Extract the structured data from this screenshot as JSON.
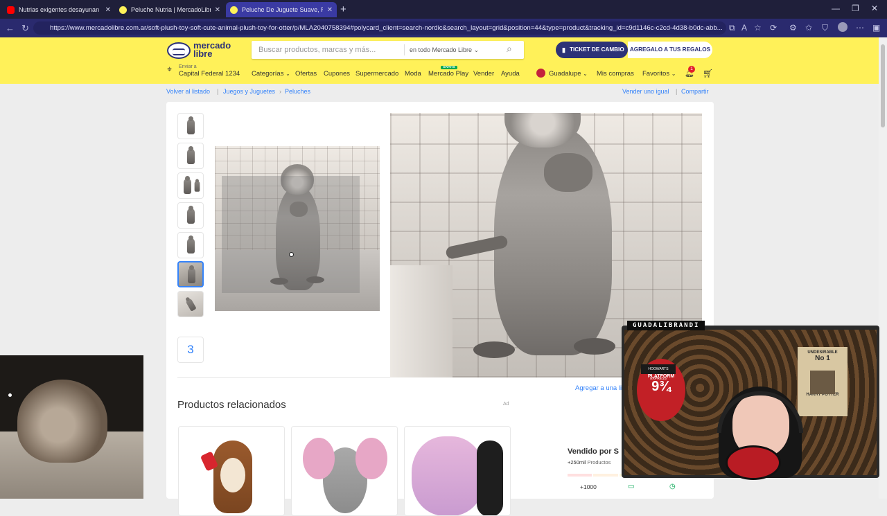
{
  "browser": {
    "tabs": [
      {
        "title": "Nutrias exigentes desayunan con",
        "favicon_color": "#ff0000"
      },
      {
        "title": "Peluche Nutria | MercadoLibre 📦",
        "favicon_color": "#fff159"
      },
      {
        "title": "Peluche De Juguete Suave, Regalo",
        "favicon_color": "#fff159"
      }
    ],
    "new_tab": "+",
    "url": "https://www.mercadolibre.com.ar/soft-plush-toy-soft-cute-animal-plush-toy-for-otter/p/MLA2040758394#polycard_client=search-nordic&search_layout=grid&position=44&type=product&tracking_id=c9d1146c-c2cd-4d38-b0dc-abb..."
  },
  "header": {
    "logo_line1": "mercado",
    "logo_line2": "libre",
    "search_placeholder": "Buscar productos, marcas y más...",
    "search_scope": "en todo Mercado Libre",
    "ticket_button": "TICKET DE CAMBIO",
    "regalo_button": "AGREGALO A TUS REGALOS",
    "location_label": "Enviar a",
    "location_value": "Capital Federal 1234",
    "nav": [
      "Categorías",
      "Ofertas",
      "Cupones",
      "Supermercado",
      "Moda",
      "Mercado Play",
      "Vender",
      "Ayuda"
    ],
    "gratis_badge": "GRATIS",
    "user": "Guadalupe",
    "mis_compras": "Mis compras",
    "favoritos": "Favoritos",
    "notif_count": "1"
  },
  "breadcrumb": {
    "back": "Volver al listado",
    "items": [
      "Juegos y Juguetes",
      "Peluches"
    ],
    "vender": "Vender uno igual",
    "compartir": "Compartir"
  },
  "gallery": {
    "more_count": "3",
    "selected_index": 5
  },
  "related": {
    "title": "Productos relacionados",
    "ad": "Ad"
  },
  "sidebar": {
    "agregar": "Agregar a una lis",
    "vendido_por": "Vendido por S",
    "ventas_count": "+250mil",
    "ventas_label": "Productos",
    "plus1000": "+1000"
  },
  "overlay": {
    "streamer_name": "GUADALIBRANDI",
    "sign1": "HOGWARTS EXPRESS",
    "sign2": "PLATFORM",
    "sign3": "9¾",
    "poster1": "UNDESIRABLE",
    "poster2": "No 1",
    "poster3": "HARRY POTTER"
  },
  "colors": {
    "ml_yellow": "#fff159",
    "ml_blue": "#3483fa",
    "ml_navy": "#2d3277"
  }
}
